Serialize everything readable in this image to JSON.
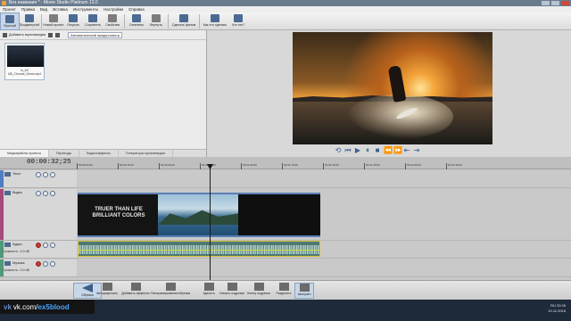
{
  "window": {
    "title": "Без названия * - Movie Studio Platinum 13.0"
  },
  "menu": [
    "Проект",
    "Правка",
    "Вид",
    "Вставка",
    "Инструменты",
    "Настройки",
    "Справка"
  ],
  "ribbon": [
    {
      "label": "Простой",
      "icon": "easy-mode-icon"
    },
    {
      "label": "Продвинутый",
      "icon": "advanced-mode-icon"
    },
    {
      "label": "Новый проект",
      "icon": "new-project-icon"
    },
    {
      "label": "Открыть",
      "icon": "open-icon"
    },
    {
      "label": "Сохранить",
      "icon": "save-icon"
    },
    {
      "label": "Свойства",
      "icon": "properties-icon"
    },
    {
      "label": "Отменить",
      "icon": "undo-icon"
    },
    {
      "label": "Вернуть",
      "icon": "redo-icon"
    },
    {
      "label": "Сделать фильм",
      "icon": "make-movie-icon"
    },
    {
      "label": "Как это сделать",
      "icon": "howto-icon"
    },
    {
      "label": "Что это?",
      "icon": "help-icon"
    }
  ],
  "media": {
    "add_label": "Добавить мультимедиа",
    "auto_preview_label": "Автоматический предпросмотр",
    "item_caption": "in_4K UB_Chrome_Demo.mp4"
  },
  "lefttabs": [
    "Медиафайлы проекта",
    "Переходы",
    "Видеоэффекты",
    "Генераторы мультимедиа"
  ],
  "timeline": {
    "timecode": "00:00:32;25",
    "ruler_ticks": [
      "00:00:00;00",
      "00:00:15;00",
      "00:00:30;00",
      "00:00:45;00",
      "00:01:00;00",
      "00:01:15;00",
      "00:01:30;00",
      "00:01:45;00",
      "00:02:00;00",
      "00:02:15;00"
    ],
    "tracks": [
      {
        "name": "Текст",
        "type": "text"
      },
      {
        "name": "Видео",
        "type": "video"
      },
      {
        "name": "Аудио",
        "type": "audio",
        "sub": "Громкость: -0,0 dB"
      },
      {
        "name": "Музыка",
        "type": "music",
        "sub": "Громкость: -0,0 dB"
      }
    ],
    "clip_text": "TRUER THAN LIFE BRILLIANT COLORS"
  },
  "bottombar": [
    {
      "label": "Обрезка",
      "icon": "trim-icon"
    },
    {
      "label": "Авторазрезать",
      "icon": "auto-cut-icon"
    },
    {
      "label": "Добавить эффекты",
      "icon": "effects-icon"
    },
    {
      "label": "Панорамирование/обрезка",
      "icon": "pan-crop-icon"
    },
    {
      "label": "Удалить",
      "icon": "delete-icon"
    },
    {
      "label": "Начало подрезки",
      "icon": "trim-start-icon"
    },
    {
      "label": "Конец подрезки",
      "icon": "trim-end-icon"
    },
    {
      "label": "Разделить",
      "icon": "split-icon"
    },
    {
      "label": "Автоузел",
      "icon": "auto-ripple-icon"
    }
  ],
  "watermark": {
    "vk": "vk",
    "prefix": "vk.com/",
    "handle": "ex5blood"
  },
  "tray": {
    "lang": "RU",
    "time": "20:26",
    "date": "10.11.2016"
  }
}
